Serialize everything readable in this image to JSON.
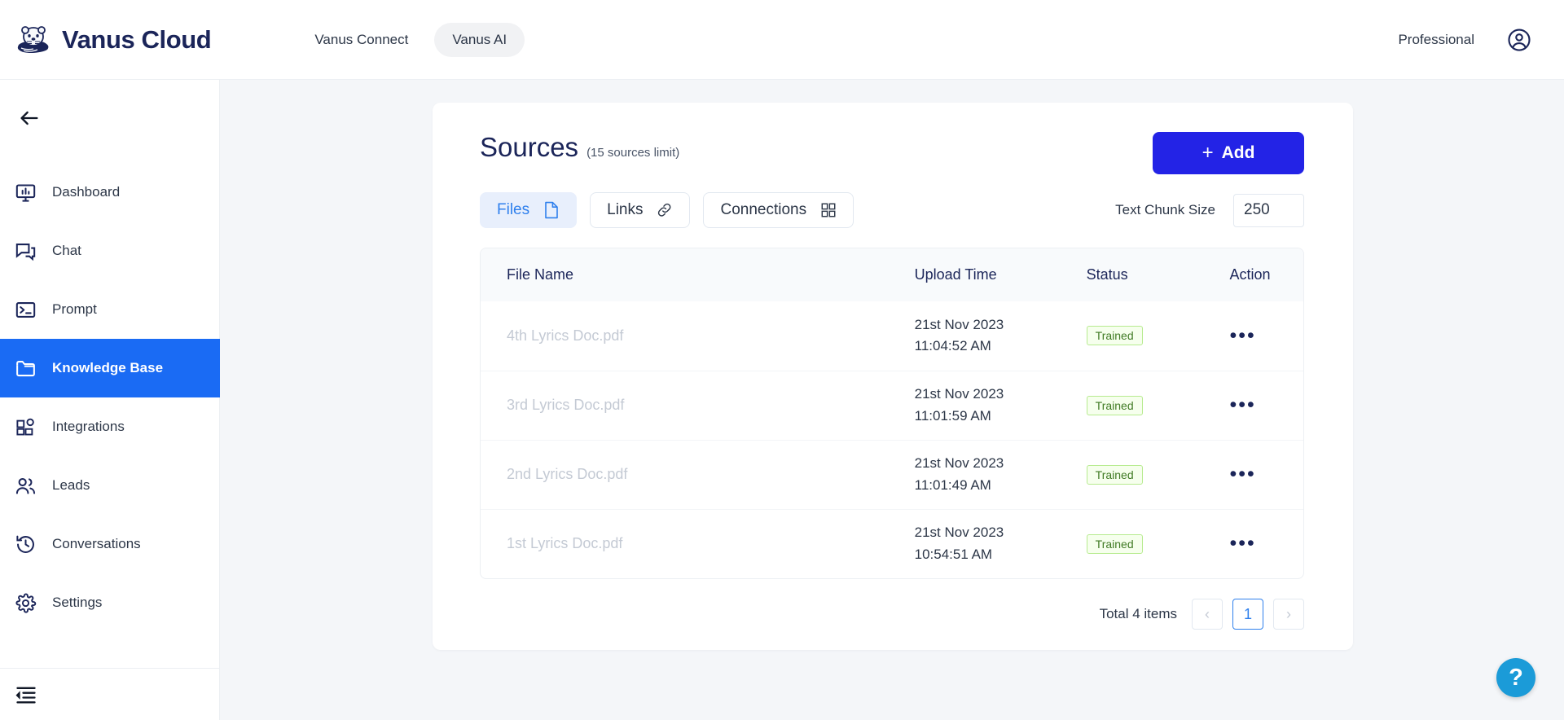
{
  "topbar": {
    "brand_name": "Vanus Cloud",
    "nav": [
      {
        "label": "Vanus Connect",
        "active": false
      },
      {
        "label": "Vanus AI",
        "active": true
      }
    ],
    "plan": "Professional"
  },
  "sidebar": {
    "items": [
      {
        "label": "Dashboard",
        "icon": "monitor-icon"
      },
      {
        "label": "Chat",
        "icon": "chat-icon"
      },
      {
        "label": "Prompt",
        "icon": "terminal-icon"
      },
      {
        "label": "Knowledge Base",
        "icon": "folder-icon"
      },
      {
        "label": "Integrations",
        "icon": "integrations-icon"
      },
      {
        "label": "Leads",
        "icon": "users-icon"
      },
      {
        "label": "Conversations",
        "icon": "history-icon"
      },
      {
        "label": "Settings",
        "icon": "gear-icon"
      }
    ],
    "active_index": 3
  },
  "page": {
    "title": "Sources",
    "title_sub": "(15 sources limit)",
    "add_label": "Add",
    "add_plus": "+",
    "accent_color": "#2323e6",
    "active_nav_color": "#1a6bf4"
  },
  "tabs": [
    {
      "label": "Files",
      "icon": "file-icon",
      "active": true
    },
    {
      "label": "Links",
      "icon": "link-icon",
      "active": false
    },
    {
      "label": "Connections",
      "icon": "grid-icon",
      "active": false
    }
  ],
  "chunk": {
    "label": "Text Chunk Size",
    "value": "250",
    "placeholder": "250"
  },
  "table": {
    "headers": [
      "File Name",
      "Upload Time",
      "Status",
      "Action"
    ],
    "rows": [
      {
        "file": "4th Lyrics Doc.pdf",
        "date": "21st Nov 2023",
        "time": "11:04:52 AM",
        "status": "Trained"
      },
      {
        "file": "3rd Lyrics Doc.pdf",
        "date": "21st Nov 2023",
        "time": "11:01:59 AM",
        "status": "Trained"
      },
      {
        "file": "2nd Lyrics Doc.pdf",
        "date": "21st Nov 2023",
        "time": "11:01:49 AM",
        "status": "Trained"
      },
      {
        "file": "1st Lyrics Doc.pdf",
        "date": "21st Nov 2023",
        "time": "10:54:51 AM",
        "status": "Trained"
      }
    ],
    "status_color": "#3f7a23",
    "status_bg": "#f6ffed"
  },
  "pagination": {
    "total": "Total 4 items",
    "prev": "‹",
    "next": "›",
    "current_page": "1"
  },
  "help": {
    "glyph": "?",
    "color": "#1b9bd8"
  },
  "action_dots": "•••"
}
